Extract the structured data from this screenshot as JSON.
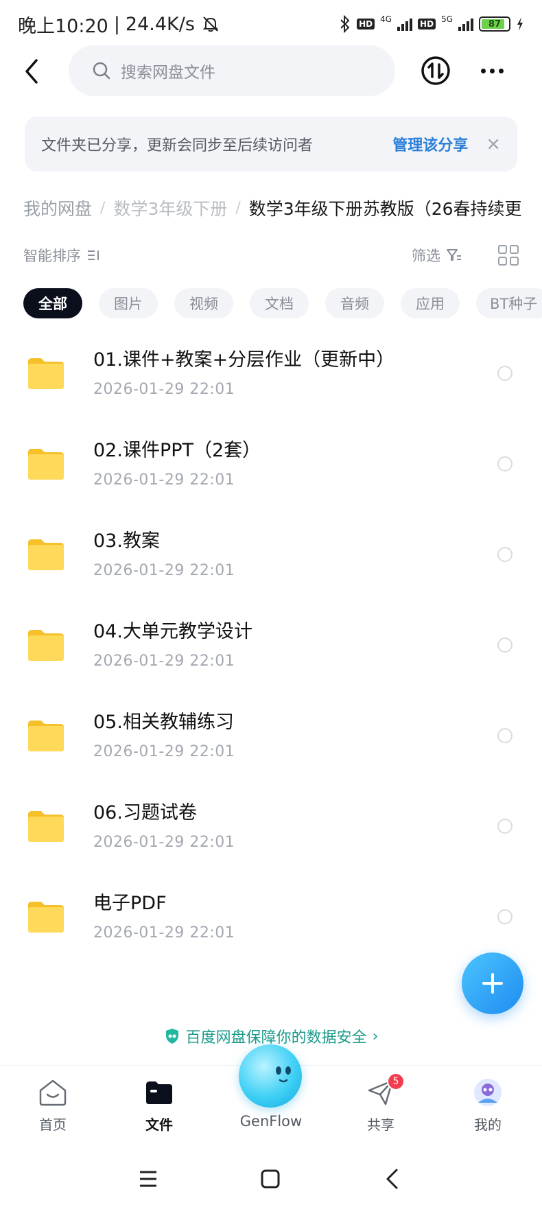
{
  "status_bar": {
    "time": "晚上10:20",
    "separator": "|",
    "speed": "24.4K/s",
    "hd1": "HD",
    "net1": "4G",
    "hd2": "HD",
    "net2": "5G",
    "battery": "87",
    "battery_level": 0.87
  },
  "search": {
    "placeholder": "搜索网盘文件"
  },
  "notice": {
    "text": "文件夹已分享，更新会同步至后续访问者",
    "link": "管理该分享",
    "close": "×"
  },
  "breadcrumb": {
    "items": [
      "我的网盘",
      "数学3年级下册",
      "数学3年级下册苏教版（26春持续更"
    ],
    "separator": "/"
  },
  "toolbar": {
    "sort_label": "智能排序",
    "filter_label": "筛选"
  },
  "chips": [
    "全部",
    "图片",
    "视频",
    "文档",
    "音频",
    "应用",
    "BT种子"
  ],
  "files": [
    {
      "name": "01.课件+教案+分层作业（更新中）",
      "date": "2026-01-29  22:01"
    },
    {
      "name": "02.课件PPT（2套）",
      "date": "2026-01-29  22:01"
    },
    {
      "name": "03.教案",
      "date": "2026-01-29  22:01"
    },
    {
      "name": "04.大单元教学设计",
      "date": "2026-01-29  22:01"
    },
    {
      "name": "05.相关教辅练习",
      "date": "2026-01-29  22:01"
    },
    {
      "name": "06.习题试卷",
      "date": "2026-01-29  22:01"
    },
    {
      "name": "电子PDF",
      "date": "2026-01-29  22:01"
    }
  ],
  "safety_banner": {
    "text": "百度网盘保障你的数据安全",
    "arrow": "›"
  },
  "bottom_nav": {
    "home": "首页",
    "files": "文件",
    "genflow": "GenFlow",
    "share": "共享",
    "share_badge": "5",
    "me": "我的"
  },
  "colors": {
    "accent": "#2b7fd9",
    "folder": "#ffd43b",
    "active_chip": "#0b0f1c",
    "badge": "#f23d4f",
    "safety": "#1a9a8a"
  }
}
